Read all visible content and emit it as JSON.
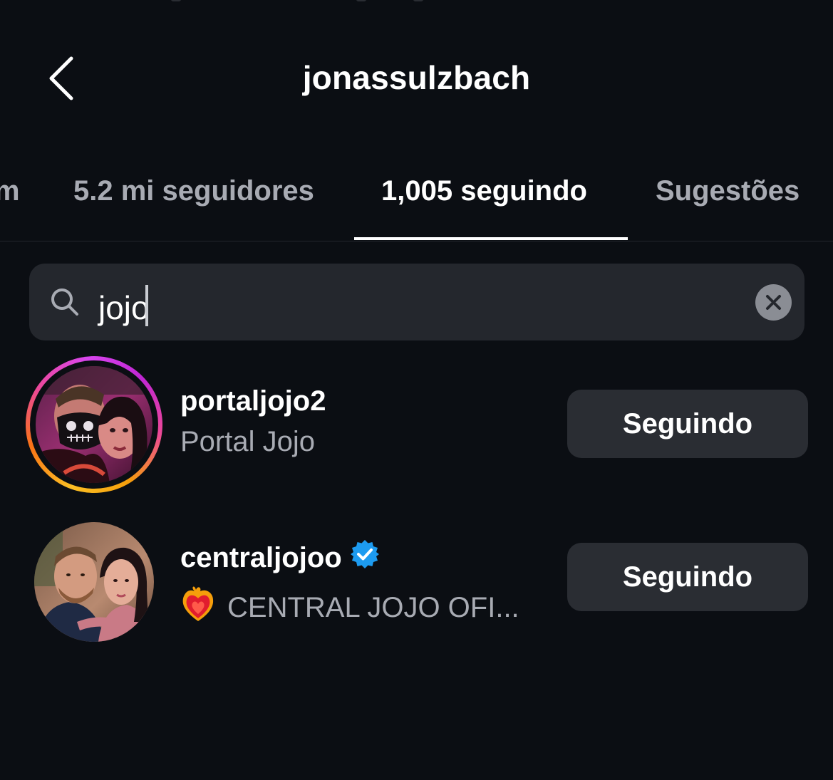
{
  "header": {
    "title": "jonassulzbach",
    "back_icon": "chevron-left-icon"
  },
  "tabs": [
    {
      "label": "m",
      "active": false
    },
    {
      "label": "5.2 mi seguidores",
      "active": false
    },
    {
      "label": "1,005 seguindo",
      "active": true
    },
    {
      "label": "Sugestões",
      "active": false
    }
  ],
  "search": {
    "value": "jojo",
    "icon": "search-icon",
    "clear_icon": "close-icon"
  },
  "results": [
    {
      "username": "portaljojo2",
      "fullname": "Portal Jojo",
      "verified": false,
      "has_story_ring": true,
      "button_label": "Seguindo"
    },
    {
      "username": "centraljojoo",
      "fullname": "CENTRAL JOJO OFI...",
      "fullname_emoji": "heart-on-fire-icon",
      "verified": true,
      "has_story_ring": false,
      "button_label": "Seguindo"
    }
  ],
  "colors": {
    "background": "#0b0e13",
    "surface": "#24272d",
    "button": "#2a2d33",
    "muted_text": "#a8abb3",
    "verified": "#1d9bf0"
  }
}
